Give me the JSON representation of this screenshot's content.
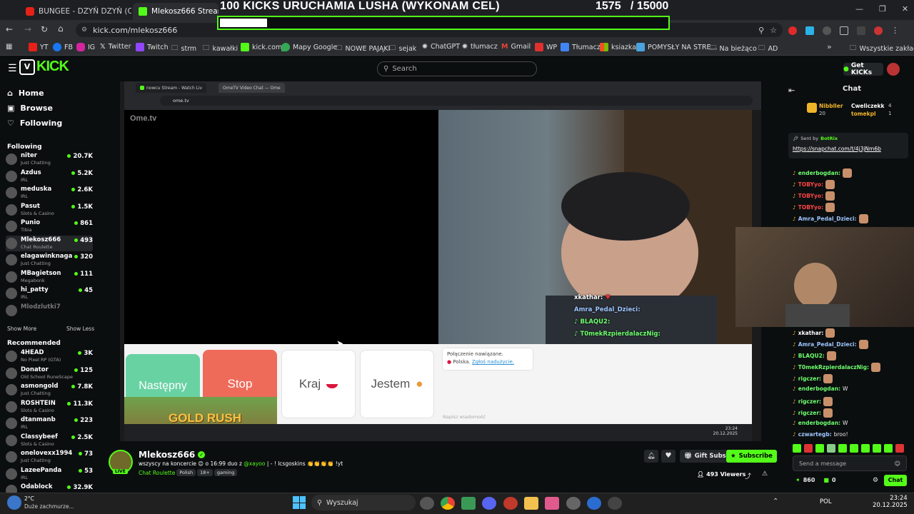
{
  "browser": {
    "tabs": [
      {
        "title": "BUNGEE - DZYŃ DZYŃ (C"
      },
      {
        "title": "Mlekosz666 Stream - Watch"
      }
    ],
    "url": "kick.com/mlekosz666",
    "bookmarks": [
      "YT",
      "FB",
      "IG",
      "Twitter",
      "Twitch",
      "strm",
      "kawałki",
      "kick.com",
      "Mapy Google",
      "NOWE PAJĄKI",
      "sejak",
      "ChatGPT",
      "tłumacz",
      "Gmail",
      "WP",
      "Tłumacz",
      "ksiazka",
      "POMYSŁY NA STRE...",
      "Na bieżąco",
      "AD"
    ],
    "all_bookmarks": "Wszystkie zakładki"
  },
  "goal": {
    "title": "100 KICKS URUCHAMIA LUSHA (WYKONAM CEL)",
    "current": 1575,
    "target": 15000,
    "count_text": "1575   / 15000",
    "progress": 0.105
  },
  "kick": {
    "search_placeholder": "Search",
    "get_kicks": "Get KICKs",
    "chat_title": "Chat"
  },
  "sidebar": {
    "nav": [
      {
        "label": "Home"
      },
      {
        "label": "Browse"
      },
      {
        "label": "Following"
      }
    ],
    "following_title": "Following",
    "following": [
      {
        "name": "niter",
        "cat": "Just Chatting",
        "viewers": "20.7K"
      },
      {
        "name": "Azdus",
        "cat": "IRL",
        "viewers": "5.2K"
      },
      {
        "name": "meduska",
        "cat": "IRL",
        "viewers": "2.6K"
      },
      {
        "name": "Pasut",
        "cat": "Slots & Casino",
        "viewers": "1.5K"
      },
      {
        "name": "Punio",
        "cat": "Tibia",
        "viewers": "861"
      },
      {
        "name": "Mlekosz666",
        "cat": "Chat Roulette",
        "viewers": "493"
      },
      {
        "name": "elagawinknaga",
        "cat": "Just Chatting",
        "viewers": "320"
      },
      {
        "name": "MBagietson",
        "cat": "Megabonk",
        "viewers": "111"
      },
      {
        "name": "hi_patty",
        "cat": "IRL",
        "viewers": "45"
      },
      {
        "name": "Mlodzlutki7",
        "cat": "",
        "viewers": ""
      }
    ],
    "show_more": "Show More",
    "show_less": "Show Less",
    "recommended_title": "Recommended",
    "recommended": [
      {
        "name": "4HEAD",
        "cat": "No Pixel RP (GTA)",
        "viewers": "3K"
      },
      {
        "name": "Donator",
        "cat": "Old School RuneScape",
        "viewers": "125"
      },
      {
        "name": "asmongold",
        "cat": "Just Chatting",
        "viewers": "7.8K"
      },
      {
        "name": "ROSHTEIN",
        "cat": "Slots & Casino",
        "viewers": "11.3K"
      },
      {
        "name": "dtanmanb",
        "cat": "IRL",
        "viewers": "223"
      },
      {
        "name": "Classybeef",
        "cat": "Slots & Casino",
        "viewers": "2.5K"
      },
      {
        "name": "onelovexx1994",
        "cat": "Just Chatting",
        "viewers": "73"
      },
      {
        "name": "LazeePanda",
        "cat": "IRL",
        "viewers": "53"
      },
      {
        "name": "Odablock",
        "cat": "",
        "viewers": "32.9K"
      }
    ]
  },
  "inner_browser": {
    "tab1": "nowcu Stream - Watch Liv",
    "tab2": "OmeTV Video Chat — Ome",
    "url": "ome.tv",
    "logo": "Ome.tv"
  },
  "ometv": {
    "next": "Następny",
    "stop": "Stop",
    "country": "Kraj",
    "me": "Jestem",
    "connected": "Połączenie nawiązane.",
    "country_name": "Polska.",
    "report": "Zgłoś nadużycie.",
    "msg_placeholder": "Napisz wiadomość",
    "time": "23:24",
    "date": "20.12.2025"
  },
  "overlay_game": "GOLD RUSH",
  "overlay_chat": [
    {
      "user": "xkathar:",
      "color": "#ffffff"
    },
    {
      "user": "Amra_Pedal_Dzieci:",
      "color": "#9ec6ff"
    },
    {
      "user": "BLAQU2:",
      "color": "#6dff6d"
    },
    {
      "user": "T0mekRzpierdalaczNig:",
      "color": "#6dff6d"
    }
  ],
  "stream": {
    "streamer": "Mlekosz666",
    "title_pre": "wszyscy na koncercie 😊 o 16:99 duo z",
    "title_mention": "@xayoo",
    "title_post": "| - ! lcsgoskins 👏👏👏👏 !yt",
    "category": "Chat Roulette",
    "tags": [
      "Polish",
      "18+",
      "gaming"
    ],
    "live": "LIVE",
    "viewers": "493 Viewers",
    "gift_subs": "Gift Subs",
    "subscribe": "Subscribe"
  },
  "chat": {
    "top_users": [
      {
        "name": "Nibbller",
        "count": "20"
      },
      {
        "name": "Cweliczekk",
        "count": "4"
      },
      {
        "name": "tomekpl",
        "count": "1"
      }
    ],
    "pinned_by": "Sent by",
    "pinned_by_user": "BotRix",
    "pinned_link": "https://snapchat.com/t/4j3jNm6b",
    "messages": [
      {
        "user": "enderbogdan:",
        "color": "#6dff6d",
        "text": "",
        "emote": true
      },
      {
        "user": "TOBYyo:",
        "color": "#ff4444",
        "text": "",
        "emote": true
      },
      {
        "user": "TOBYyo:",
        "color": "#ff4444",
        "text": "",
        "emote": true
      },
      {
        "user": "TOBYyo:",
        "color": "#ff4444",
        "text": "",
        "emote": true
      },
      {
        "user": "Amra_Pedal_Dzieci:",
        "color": "#9ec6ff",
        "text": "",
        "emote": true
      },
      {
        "user": "xkathar:",
        "color": "#ffffff",
        "text": "",
        "emote": true
      },
      {
        "user": "Amra_Pedal_Dzieci:",
        "color": "#9ec6ff",
        "text": "",
        "emote": true
      },
      {
        "user": "BLAQU2:",
        "color": "#6dff6d",
        "text": "",
        "emote": true
      },
      {
        "user": "T0mekRzpierdalaczNig:",
        "color": "#6dff6d",
        "text": "",
        "emote": true
      },
      {
        "user": "rigczer:",
        "color": "#6dff6d",
        "text": "",
        "emote": true
      },
      {
        "user": "enderbogdan:",
        "color": "#6dff6d",
        "text": "W",
        "emote": false
      },
      {
        "user": "rigczer:",
        "color": "#6dff6d",
        "text": "",
        "emote": true
      },
      {
        "user": "rigczer:",
        "color": "#6dff6d",
        "text": "",
        "emote": true
      },
      {
        "user": "enderbogdan:",
        "color": "#6dff6d",
        "text": "W",
        "emote": false
      },
      {
        "user": "czwartegb:",
        "color": "#9ec6ff",
        "text": "broo!",
        "emote": false
      }
    ],
    "input_placeholder": "Send a message",
    "points": "860",
    "kicks": "0",
    "chat_button": "Chat"
  },
  "taskbar": {
    "weather_temp": "2°C",
    "weather_desc": "Duże zachmurze...",
    "search": "Wyszukaj",
    "lang": "POL",
    "time": "23:24",
    "date": "20.12.2025"
  },
  "colors": {
    "kick_green": "#53fc18",
    "stop_red": "#ee6b5a",
    "next_green": "#69d2a3"
  }
}
